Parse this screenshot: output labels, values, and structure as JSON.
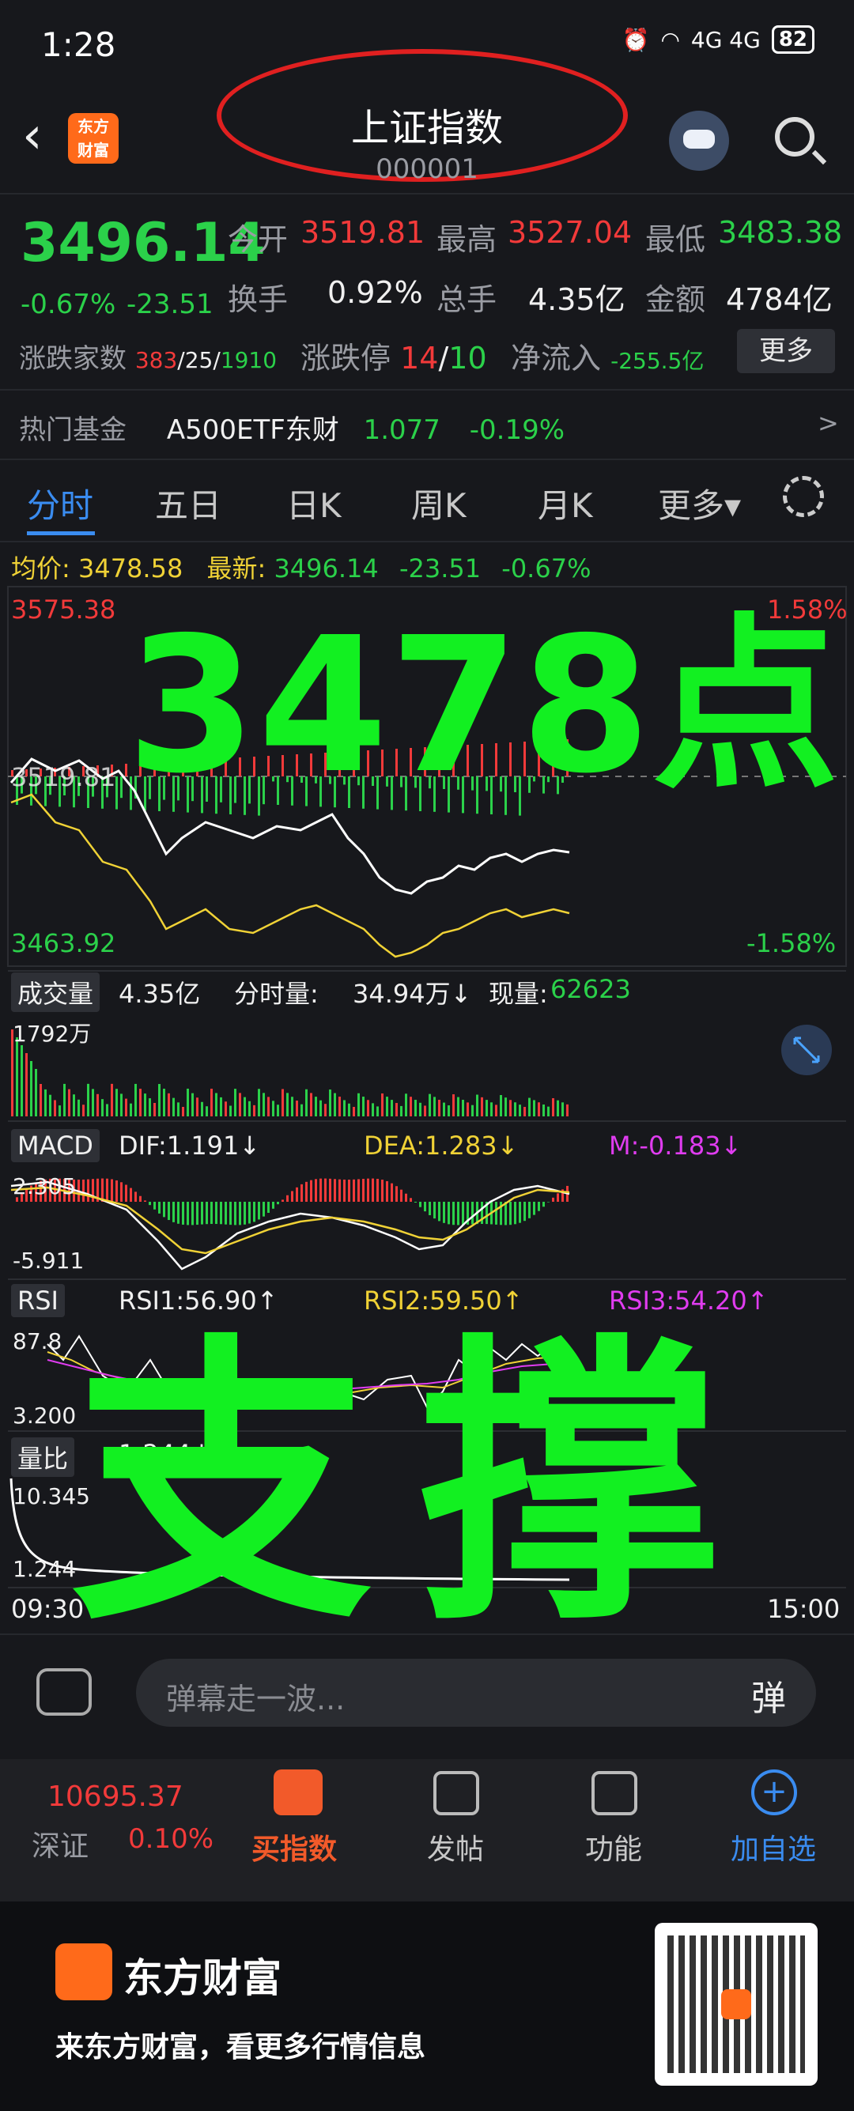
{
  "status": {
    "time": "1:28",
    "network": "4G 4G",
    "battery": "82"
  },
  "header": {
    "title": "上证指数",
    "code": "000001"
  },
  "quote": {
    "price": "3496.14",
    "chg_pct": "-0.67%",
    "chg_val": "-23.51",
    "open_label": "今开",
    "open": "3519.81",
    "high_label": "最高",
    "high": "3527.04",
    "low_label": "最低",
    "low": "3483.38",
    "turnover_label": "换手",
    "turnover": "0.92%",
    "volume_label": "总手",
    "volume": "4.35亿",
    "amount_label": "金额",
    "amount": "4784亿",
    "breadth_label": "涨跌家数",
    "breadth_up": "383",
    "breadth_flat": "25",
    "breadth_down": "1910",
    "limit_label": "涨跌停",
    "limit_up": "14",
    "limit_down": "10",
    "inflow_label": "净流入",
    "inflow": "-255.5亿",
    "more_label": "更多"
  },
  "funds": {
    "label": "热门基金",
    "name": "A500ETF东财",
    "price": "1.077",
    "chg": "-0.19%",
    "arrow": ">"
  },
  "tabs": [
    "分时",
    "五日",
    "日K",
    "周K",
    "月K",
    "更多▾"
  ],
  "intraday": {
    "avg_label": "均价:",
    "avg": "3478.58",
    "last_label": "最新:",
    "last": "3496.14",
    "chg": "-23.51",
    "pct": "-0.67%",
    "top_price": "3575.38",
    "top_pct": "1.58%",
    "bottom_price": "3463.92",
    "bottom_pct": "-1.58%",
    "mid_price": "3519.81",
    "vol_box": "成交量",
    "vol_total": "4.35亿",
    "vol_split_label": "分时量:",
    "vol_split": "34.94万↓",
    "vol_now_label": "现量:",
    "vol_now": "62623",
    "vol_max": "1792万",
    "macd_box": "MACD",
    "dif": "DIF:1.191↓",
    "dea": "DEA:1.283↓",
    "m": "M:-0.183↓",
    "macd_top": "2.305",
    "macd_bottom": "-5.911",
    "rsi_box": "RSI",
    "rsi1": "RSI1:56.90↑",
    "rsi2": "RSI2:59.50↑",
    "rsi3": "RSI3:54.20↑",
    "rsi_top": "87.8",
    "rsi_bottom": "3.200",
    "lb_box": "量比",
    "lb": "1.244↓",
    "lb_top": "10.345",
    "lb_bottom": "1.244",
    "time_start": "09:30",
    "time_end": "15:00"
  },
  "overlay": {
    "big_number": "3478点",
    "big_text": "支撑"
  },
  "comment": {
    "placeholder": "弹幕走一波...",
    "danmaku": "弹"
  },
  "bottom_nav": {
    "index_price": "10695.37",
    "index_name": "深证",
    "index_pct": "0.10%",
    "buy_index": "买指数",
    "post": "发帖",
    "functions": "功能",
    "add_watch": "加自选"
  },
  "footer": {
    "brand": "东方财富",
    "slogan": "来东方财富，看更多行情信息"
  },
  "colors": {
    "up": "#f23a3a",
    "down": "#2bd14a",
    "avg": "#f0d236",
    "overlay": "#12f021"
  }
}
